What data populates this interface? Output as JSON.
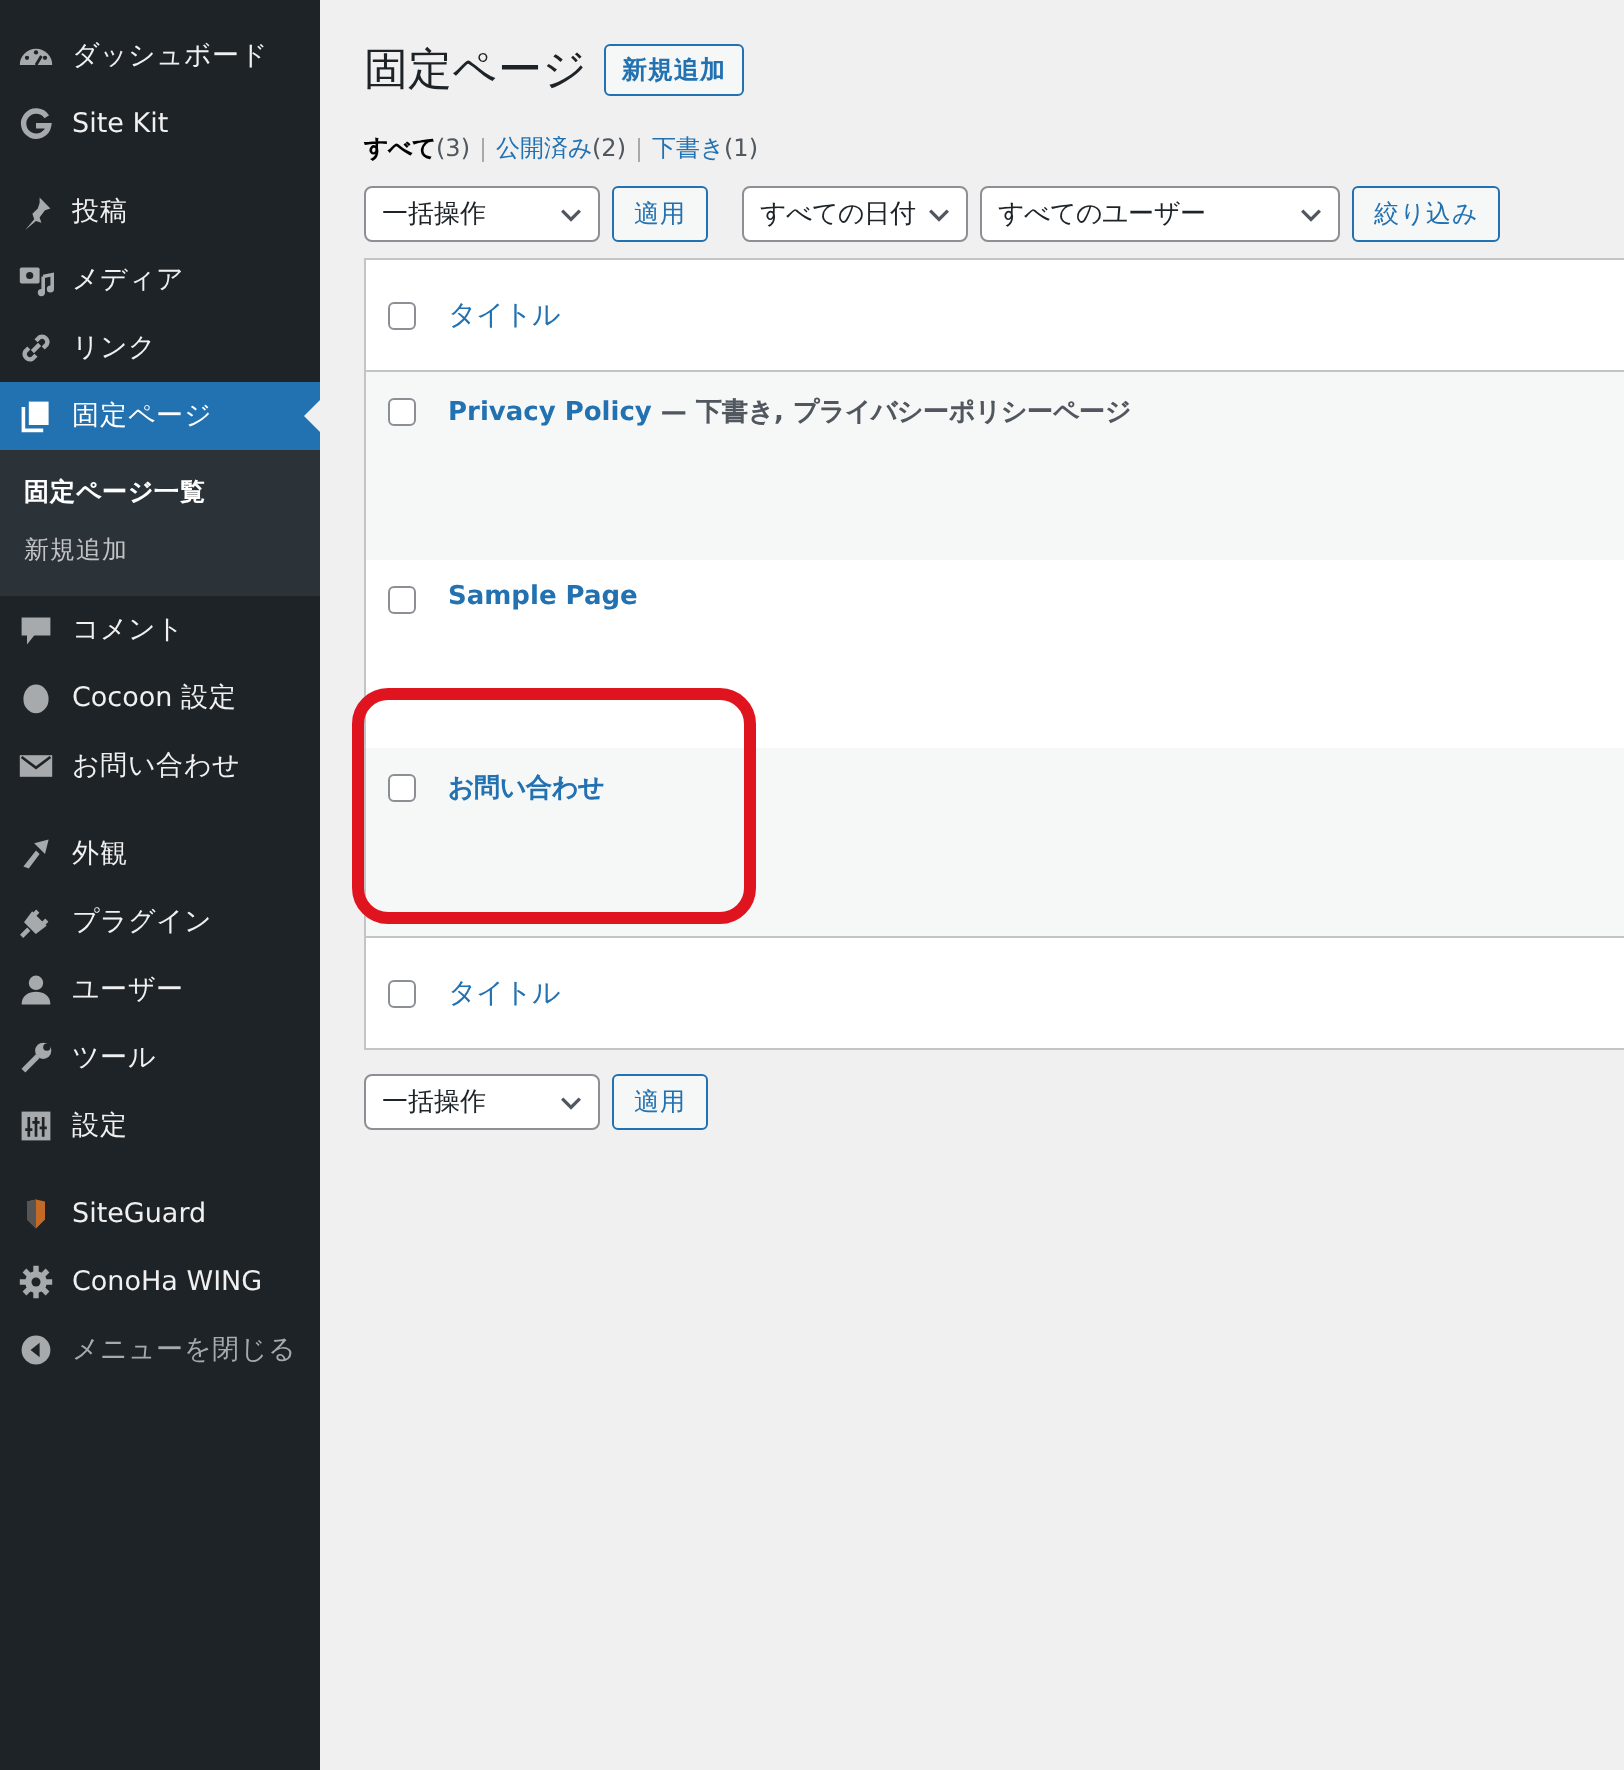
{
  "sidebar": {
    "groups": [
      {
        "items": [
          {
            "label": "ダッシュボード",
            "selected": false
          },
          {
            "label": "Site Kit",
            "selected": false
          }
        ]
      },
      {
        "items": [
          {
            "label": "投稿",
            "selected": false
          },
          {
            "label": "メディア",
            "selected": false
          },
          {
            "label": "リンク",
            "selected": false
          },
          {
            "label": "固定ページ",
            "selected": true,
            "children": [
              {
                "label": "固定ページ一覧",
                "selected": true
              },
              {
                "label": "新規追加",
                "selected": false
              }
            ]
          },
          {
            "label": "コメント",
            "selected": false
          },
          {
            "label": "Cocoon 設定",
            "selected": false
          },
          {
            "label": "お問い合わせ",
            "selected": false
          }
        ]
      },
      {
        "items": [
          {
            "label": "外観",
            "selected": false
          },
          {
            "label": "プラグイン",
            "selected": false
          },
          {
            "label": "ユーザー",
            "selected": false
          },
          {
            "label": "ツール",
            "selected": false
          },
          {
            "label": "設定",
            "selected": false
          }
        ]
      },
      {
        "items": [
          {
            "label": "SiteGuard",
            "selected": false
          },
          {
            "label": "ConoHa WING",
            "selected": false
          },
          {
            "label": "メニューを閉じる",
            "selected": false,
            "kind": "collapse"
          }
        ]
      }
    ]
  },
  "page": {
    "title": "固定ページ",
    "add_button": "新規追加"
  },
  "views": [
    {
      "label": "すべて",
      "count": "(3)",
      "selected": true
    },
    {
      "label": "公開済み",
      "count": "(2)",
      "selected": false
    },
    {
      "label": "下書き",
      "count": "(1)",
      "selected": false
    }
  ],
  "filters": {
    "bulk_action": "一括操作",
    "apply": "適用",
    "dates": "すべての日付",
    "users": "すべてのユーザー",
    "filter_button": "絞り込み"
  },
  "table": {
    "header": {
      "title": "タイトル",
      "checked": false
    },
    "rows": [
      {
        "title": "Privacy Policy",
        "state": " — 下書き, プライバシーポリシーページ",
        "checked": false,
        "annotated": false
      },
      {
        "title": "Sample Page",
        "checked": false,
        "annotated": false
      },
      {
        "title": "お問い合わせ",
        "checked": false,
        "annotated": true
      }
    ],
    "footer": {
      "title": "タイトル",
      "checked": false
    }
  },
  "bottom_filters": {
    "bulk_action": "一括操作",
    "apply": "適用"
  }
}
